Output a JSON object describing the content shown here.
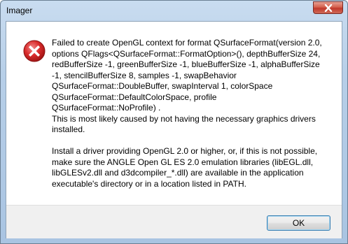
{
  "window": {
    "title": "Imager"
  },
  "dialog": {
    "icon": "error-icon",
    "message_paragraph_1": "Failed to create OpenGL context for format QSurfaceFormat(version 2.0,\noptions QFlags<QSurfaceFormat::FormatOption>(), depthBufferSize 24,\nredBufferSize -1, greenBufferSize -1, blueBufferSize -1, alphaBufferSize\n-1, stencilBufferSize 8, samples -1, swapBehavior\nQSurfaceFormat::DoubleBuffer, swapInterval 1, colorSpace\nQSurfaceFormat::DefaultColorSpace, profile\nQSurfaceFormat::NoProfile) .\nThis is most likely caused by not having the necessary graphics drivers\ninstalled.",
    "message_paragraph_2": "Install a driver providing OpenGL 2.0 or higher, or, if this is not possible,\nmake sure the ANGLE Open GL ES 2.0 emulation libraries (libEGL.dll,\nlibGLESv2.dll and d3dcompiler_*.dll) are available in the application\nexecutable's directory or in a location listed in PATH.",
    "ok_label": "OK"
  },
  "colors": {
    "error_red": "#d92b2b",
    "close_button_red": "#c0392b",
    "footer_bg": "#f0f0f0",
    "title_bar": "#b7cfe8"
  }
}
